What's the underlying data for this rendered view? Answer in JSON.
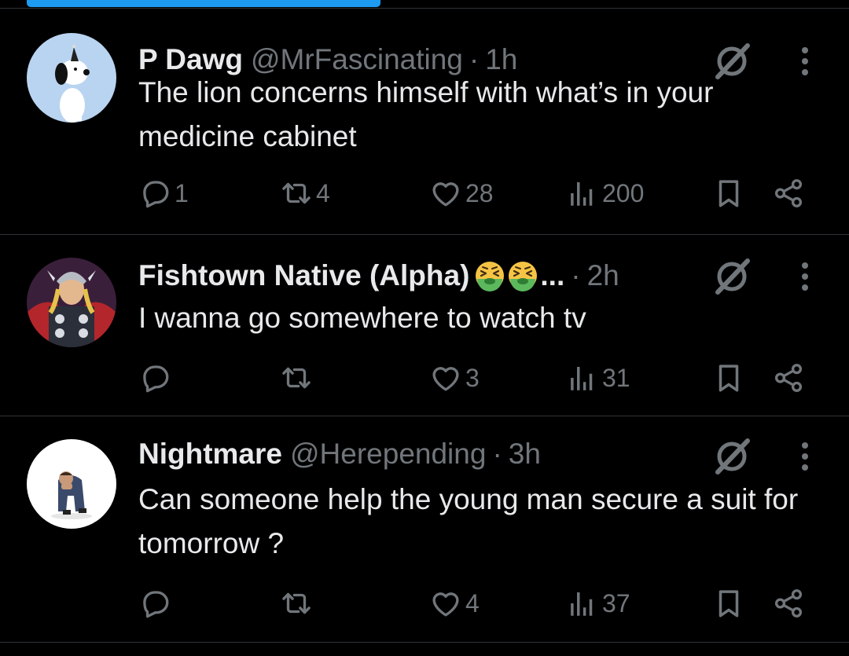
{
  "colors": {
    "background": "#000000",
    "text": "#e7e9ea",
    "muted": "#71767b",
    "accent": "#1d9bf0",
    "divider": "#2f3336"
  },
  "tweets": [
    {
      "avatar": "snoopy-avatar",
      "name": "P Dawg",
      "handle": "@MrFascinating",
      "separator": "·",
      "time": "1h",
      "text": "The lion concerns himself with what’s in your medicine cabinet",
      "replies": "1",
      "reposts": "4",
      "likes": "28",
      "views": "200"
    },
    {
      "avatar": "thor-avatar",
      "name": "Fishtown Native (Alpha)",
      "name_emoji": [
        "nauseated-face-emoji",
        "nauseated-face-emoji"
      ],
      "truncation": "...",
      "separator": "·",
      "time": "2h",
      "text": "I wanna go somewhere to watch tv",
      "replies": "",
      "reposts": "",
      "likes": "3",
      "views": "31"
    },
    {
      "avatar": "sad-man-avatar",
      "name": "Nightmare",
      "handle": "@Herepending",
      "separator": "·",
      "time": "3h",
      "text": "Can someone help the young man secure a suit for tomorrow ?",
      "replies": "",
      "reposts": "",
      "likes": "4",
      "views": "37"
    }
  ]
}
